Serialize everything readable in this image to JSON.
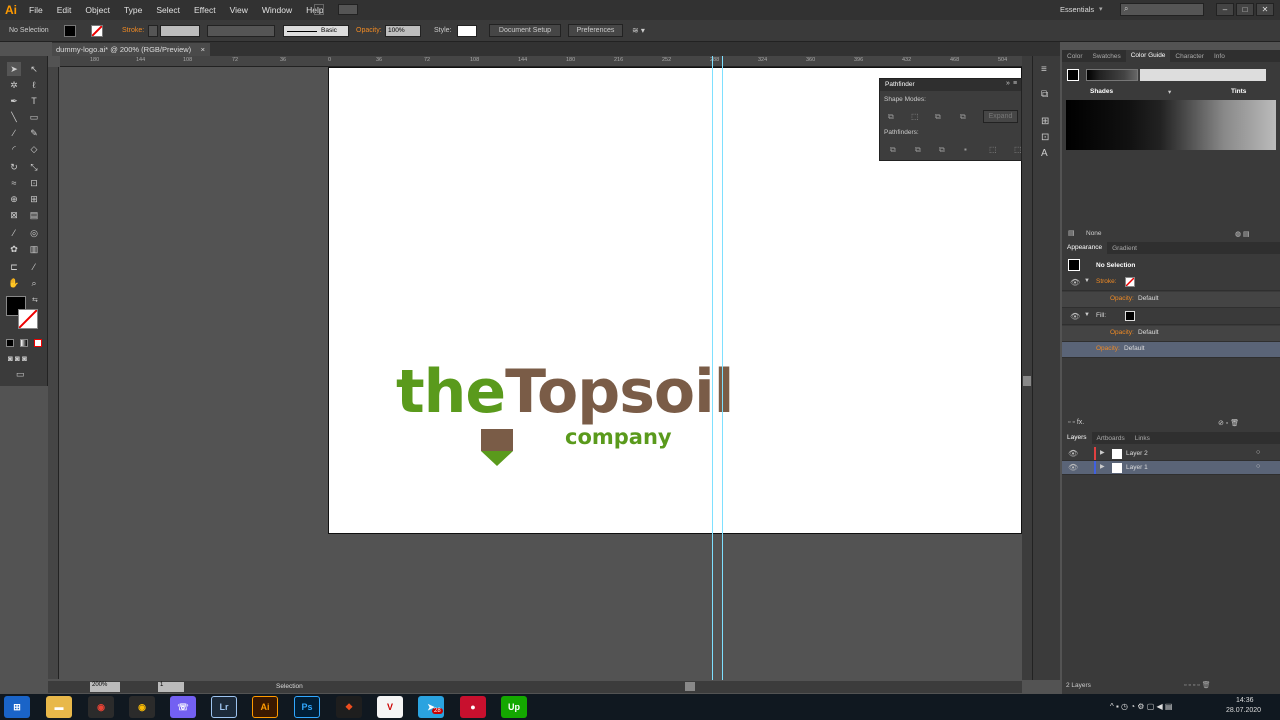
{
  "app": {
    "logo": "Ai"
  },
  "menu": [
    "File",
    "Edit",
    "Object",
    "Type",
    "Select",
    "Effect",
    "View",
    "Window",
    "Help"
  ],
  "workspace": {
    "label": "Essentials"
  },
  "control_bar": {
    "selection": "No Selection",
    "stroke_label": "Stroke:",
    "brush": "Basic",
    "opacity_label": "Opacity:",
    "opacity_value": "100%",
    "style_label": "Style:",
    "document_setup": "Document Setup",
    "preferences": "Preferences"
  },
  "doc_tab": {
    "title": "dummy-logo.ai* @ 200% (RGB/Preview)",
    "close": "×"
  },
  "ruler_h": [
    "180",
    "144",
    "108",
    "72",
    "36",
    "0",
    "36",
    "72",
    "108",
    "144",
    "180",
    "216",
    "252",
    "288",
    "324",
    "360",
    "396",
    "432",
    "468",
    "504"
  ],
  "logo": {
    "the": "the",
    "topsoil": "Topsoil",
    "company": "company",
    "green": "#5a9a1c",
    "brown": "#7a5c47"
  },
  "pathfinder": {
    "title": "Pathfinder",
    "shape_modes": "Shape Modes:",
    "expand": "Expand",
    "pathfinders": "Pathfinders:"
  },
  "color_panel": {
    "tabs": [
      "Color",
      "Swatches",
      "Color Guide",
      "Character",
      "Info"
    ],
    "active": "Color Guide",
    "shades": "Shades",
    "tints": "Tints",
    "none": "None"
  },
  "appearance": {
    "tabs": [
      "Appearance",
      "Gradient"
    ],
    "title": "No Selection",
    "stroke": "Stroke:",
    "opacity": "Opacity:",
    "default": "Default",
    "fill": "Fill:"
  },
  "layers": {
    "tabs": [
      "Layers",
      "Artboards",
      "Links"
    ],
    "items": [
      "Layer 2",
      "Layer 1"
    ],
    "count": "2 Layers"
  },
  "status": {
    "zoom": "200%",
    "page": "1",
    "tool": "Selection"
  },
  "taskbar": {
    "time": "14:36",
    "date": "28.07.2020",
    "badge": "28"
  }
}
